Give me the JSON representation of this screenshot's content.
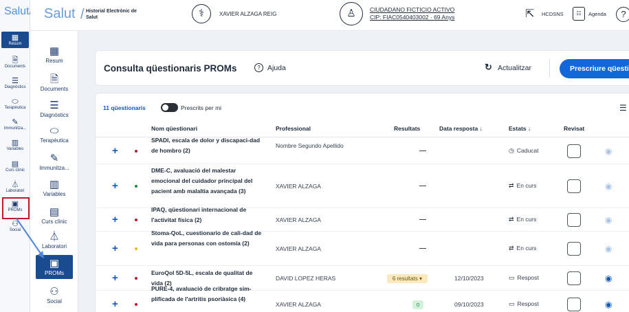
{
  "mini_sidebar": {
    "brand": "Salut/",
    "items": [
      {
        "label": "Resum",
        "icon": "grid-icon",
        "glyph": "▦",
        "active": true
      },
      {
        "label": "Documents",
        "icon": "document-icon",
        "glyph": "🗎"
      },
      {
        "label": "Diagnòstics",
        "icon": "list-icon",
        "glyph": "☰"
      },
      {
        "label": "Terapèutica",
        "icon": "pill-icon",
        "glyph": "⬭"
      },
      {
        "label": "Immunitza...",
        "icon": "syringe-icon",
        "glyph": "✎"
      },
      {
        "label": "Variables",
        "icon": "chart-icon",
        "glyph": "▥"
      },
      {
        "label": "Curs clínic",
        "icon": "clipboard-icon",
        "glyph": "▤"
      },
      {
        "label": "Laboratori",
        "icon": "flask-icon",
        "glyph": "⏃"
      },
      {
        "label": "PROMs",
        "icon": "form-icon",
        "glyph": "▣"
      },
      {
        "label": "Social",
        "icon": "people-icon",
        "glyph": "⚇"
      }
    ]
  },
  "sidebar": {
    "items": [
      {
        "label": "Resum",
        "icon": "grid-icon",
        "glyph": "▦"
      },
      {
        "label": "Documents",
        "icon": "document-icon",
        "glyph": "🗎"
      },
      {
        "label": "Diagnòstics",
        "icon": "list-icon",
        "glyph": "☰"
      },
      {
        "label": "Terapèutica",
        "icon": "pill-icon",
        "glyph": "⬭"
      },
      {
        "label": "Immunitza...",
        "icon": "syringe-icon",
        "glyph": "✎"
      },
      {
        "label": "Variables",
        "icon": "chart-icon",
        "glyph": "▥"
      },
      {
        "label": "Curs clínic",
        "icon": "clipboard-icon",
        "glyph": "▤"
      },
      {
        "label": "Laboratori",
        "icon": "flask-icon",
        "glyph": "⏃"
      },
      {
        "label": "PROMs",
        "icon": "form-icon",
        "glyph": "▣",
        "active": true
      },
      {
        "label": "Social",
        "icon": "people-icon",
        "glyph": "⚇"
      }
    ]
  },
  "header": {
    "logo": "Salut",
    "logo_sep": "/",
    "logo_sub": "Historial Electrònic de Salut",
    "professional": "XAVIER ALZAGA REIG",
    "patient_name": "CIUDADANO FICTICIO ACTIVO",
    "patient_cip": "CIP: FIAC0540403002 · 69 Anys",
    "hcdsns": "HCDSNS",
    "agenda": "Agenda"
  },
  "title_card": {
    "title": "Consulta qüestionaris PROMs",
    "help": "Ajuda",
    "refresh": "Actualitzar",
    "prescribe": "Prescriure qüestionari"
  },
  "list": {
    "count": "11 qüestionaris",
    "toggle_label": "Prescrits per mi",
    "headers": {
      "name": "Nom qüestionari",
      "professional": "Professional",
      "results": "Resultats",
      "date": "Data resposta ↓",
      "status": "Estats ↓",
      "reviewed": "Revisat"
    },
    "rows": [
      {
        "name": "SPADI, escala de dolor y discapaci-dad de hombro (2)",
        "professional": "Nombre Segundo Apellido",
        "results": "",
        "result_type": "none",
        "date": "",
        "status": "Caducat",
        "status_glyph": "◷",
        "dot": "#c0182c",
        "eye": "#a9c3e6"
      },
      {
        "name": "DME-C, avaluació del malestar emocional del cuidador principal del pacient amb malaltia avançada (3)",
        "professional": "XAVIER ALZAGA",
        "results": "",
        "result_type": "none",
        "date": "",
        "status": "En curs",
        "status_glyph": "⇄",
        "dot": "#1a8a3a",
        "eye": "#a9c3e6"
      },
      {
        "name": "IPAQ, qüestionari internacional de l'activitat física (2)",
        "professional": "XAVIER ALZAGA",
        "results": "",
        "result_type": "none",
        "date": "",
        "status": "En curs",
        "status_glyph": "⇄",
        "dot": "#c0182c",
        "eye": "#a9c3e6"
      },
      {
        "name": "Stoma-QoL, cuestionario de cali-dad de vida para personas con ostomía (2)",
        "professional": "XAVIER ALZAGA",
        "results": "",
        "result_type": "none",
        "date": "",
        "status": "En curs",
        "status_glyph": "⇄",
        "dot": "#e8b72a",
        "eye": "#a9c3e6"
      },
      {
        "name": "EuroQol 5D-5L, escala de qualitat de vida (2)",
        "professional": "DAVID LOPEZ HERAS",
        "results": "6 resultats ▾",
        "result_type": "yellow",
        "date": "12/10/2023",
        "status": "Respost",
        "status_glyph": "▭",
        "dot": "#c0182c",
        "eye": "#1358b8"
      },
      {
        "name": "PURE-4, avaluació de cribratge sim-plificada de l'artritis psoriàsica (4)",
        "professional": "XAVIER ALZAGA",
        "results": "0",
        "result_type": "green",
        "date": "09/10/2023",
        "status": "Respost",
        "status_glyph": "▭",
        "dot": "#c0182c",
        "eye": "#1358b8"
      }
    ]
  }
}
